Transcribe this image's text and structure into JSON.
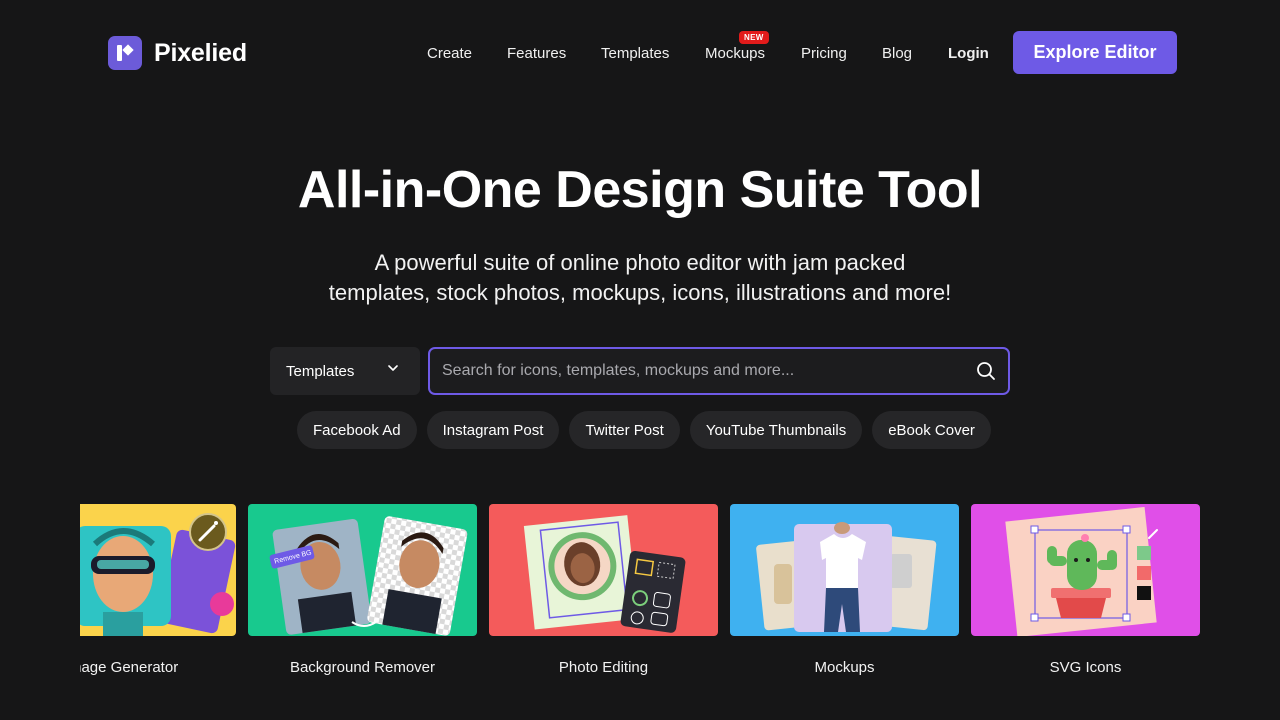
{
  "brand": {
    "name": "Pixelied"
  },
  "nav": {
    "items": [
      {
        "label": "Create"
      },
      {
        "label": "Features"
      },
      {
        "label": "Templates"
      },
      {
        "label": "Mockups",
        "badge": "NEW"
      },
      {
        "label": "Pricing"
      },
      {
        "label": "Blog"
      }
    ],
    "login": "Login",
    "cta": "Explore Editor"
  },
  "hero": {
    "title": "All-in-One Design Suite Tool",
    "subtitle_line1": "A powerful suite of online photo editor with jam packed",
    "subtitle_line2": "templates, stock photos, mockups, icons, illustrations and more!"
  },
  "search": {
    "category": "Templates",
    "value": "",
    "placeholder": "Search for icons, templates, mockups and more..."
  },
  "chips": [
    "Facebook Ad",
    "Instagram Post",
    "Twitter Post",
    "YouTube Thumbnails",
    "eBook Cover"
  ],
  "cards": [
    {
      "label": "Image Generator"
    },
    {
      "label": "Background Remover",
      "tag": "Remove BG"
    },
    {
      "label": "Photo Editing"
    },
    {
      "label": "Mockups"
    },
    {
      "label": "SVG Icons"
    }
  ],
  "colors": {
    "background": "#161617",
    "accent": "#6e5ae6",
    "badge": "#e21b1b",
    "card_image_generator": "#fbd34b",
    "card_background_remover": "#18c98e",
    "card_photo_editing": "#f45b5b",
    "card_mockups": "#3fb1f0",
    "card_svg_icons": "#e04fe8"
  }
}
